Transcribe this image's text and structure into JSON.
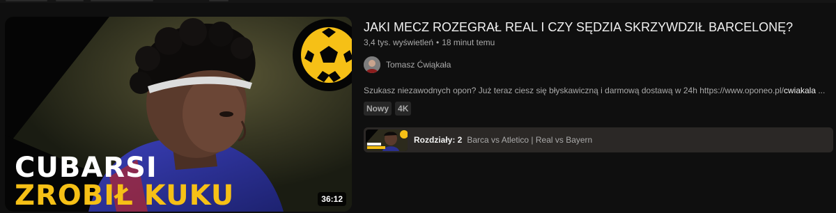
{
  "video": {
    "thumbnail": {
      "line1": "CUBARSI",
      "line2": "ZROBIŁ KUKU",
      "duration": "36:12",
      "icon": "football-icon",
      "colors": {
        "accent": "#f6c016",
        "text": "#ffffff"
      }
    },
    "title": "JAKI MECZ ROZEGRAŁ REAL I CZY SĘDZIA SKRZYWDZIŁ BARCELONĘ?",
    "views": "3,4 tys. wyświetleń",
    "age": "18 minut temu",
    "channel": {
      "name": "Tomasz Ćwiąkała"
    },
    "description": {
      "text": "Szukasz niezawodnych opon? Już teraz ciesz się błyskawiczną i darmową dostawą w 24h https://www.oponeo.pl/",
      "bold": "cwiakala",
      "ellipsis": " ..."
    },
    "badges": [
      "Nowy",
      "4K"
    ],
    "chapters": {
      "label": "Rozdziały: 2",
      "list": "Barca vs Atletico | Real vs Bayern"
    }
  }
}
